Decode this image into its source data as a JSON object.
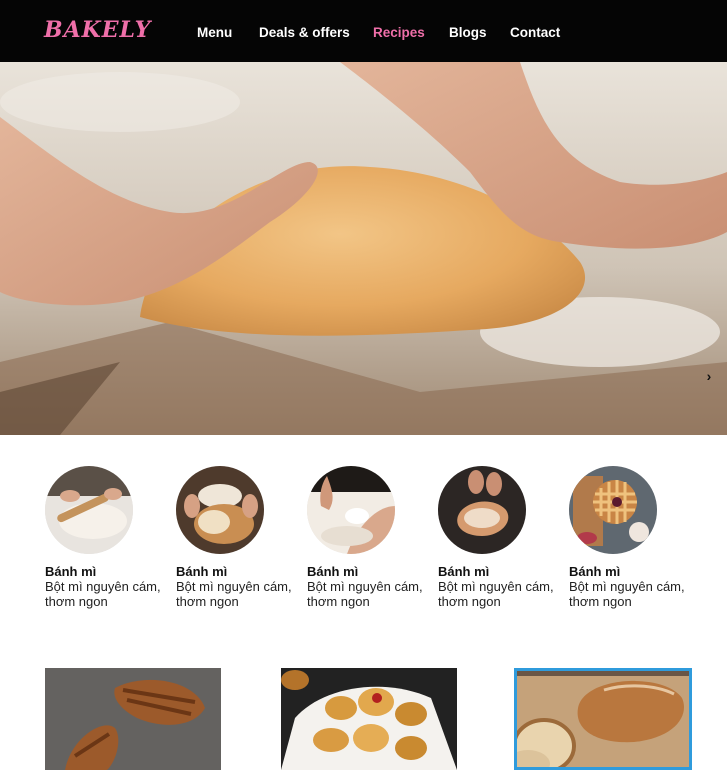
{
  "brand": {
    "logo_text": "BAKELY",
    "accent_color": "#ef6fa9"
  },
  "nav": {
    "items": [
      {
        "label": "Menu",
        "active": false
      },
      {
        "label": "Deals & offers",
        "active": false
      },
      {
        "label": "Recipes",
        "active": true
      },
      {
        "label": "Blogs",
        "active": false
      },
      {
        "label": "Contact",
        "active": false
      }
    ]
  },
  "hero": {
    "image": "hands-kneading-dough",
    "next_icon": "chevron-right-icon",
    "next_glyph": "›"
  },
  "categories": [
    {
      "title": "Bánh mì",
      "desc": "Bột mì nguyên cám, thơm ngon",
      "image": "rolling-dough"
    },
    {
      "title": "Bánh mì",
      "desc": "Bột mì nguyên cám, thơm ngon",
      "image": "bread-loaf-hands"
    },
    {
      "title": "Bánh mì",
      "desc": "Bột mì nguyên cám, thơm ngon",
      "image": "flour-hands"
    },
    {
      "title": "Bánh mì",
      "desc": "Bột mì nguyên cám, thơm ngon",
      "image": "dough-ball"
    },
    {
      "title": "Bánh mì",
      "desc": "Bột mì nguyên cám, thơm ngon",
      "image": "lattice-pie"
    }
  ],
  "products": [
    {
      "image": "croissants"
    },
    {
      "image": "pastry-basket"
    },
    {
      "image": "sliced-bread-loaf",
      "selected": true,
      "selected_color": "#2f9bdc"
    }
  ]
}
